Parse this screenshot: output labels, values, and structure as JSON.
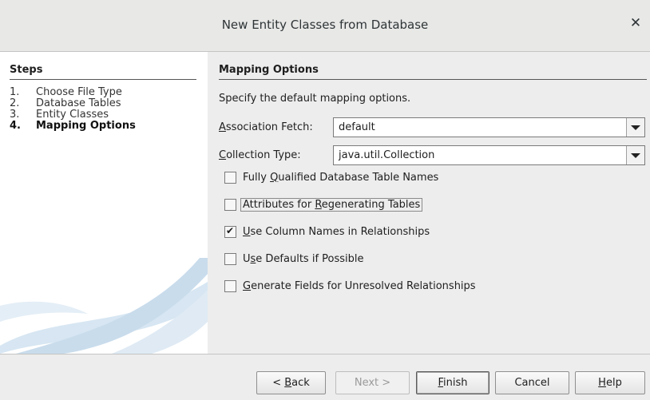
{
  "dialog": {
    "title": "New Entity Classes from Database"
  },
  "steps": {
    "heading": "Steps",
    "items": [
      {
        "num": "1.",
        "label": "Choose File Type"
      },
      {
        "num": "2.",
        "label": "Database Tables"
      },
      {
        "num": "3.",
        "label": "Entity Classes"
      },
      {
        "num": "4.",
        "label": "Mapping Options"
      }
    ]
  },
  "panel": {
    "heading": "Mapping Options",
    "description": "Specify the default mapping options.",
    "association_fetch": {
      "label_mn": "A",
      "label_rest": "ssociation Fetch:",
      "value": "default"
    },
    "collection_type": {
      "label_mn": "C",
      "label_rest": "ollection Type:",
      "value": "java.util.Collection"
    },
    "checkboxes": [
      {
        "pre": "Fully ",
        "mn": "Q",
        "post": "ualified Database Table Names",
        "checked": false
      },
      {
        "pre": "Attributes for ",
        "mn": "R",
        "post": "egenerating Tables",
        "checked": false
      },
      {
        "pre": "",
        "mn": "U",
        "post": "se Column Names in Relationships",
        "checked": true
      },
      {
        "pre": "U",
        "mn": "s",
        "post": "e Defaults if Possible",
        "checked": false
      },
      {
        "pre": "",
        "mn": "G",
        "post": "enerate Fields for Unresolved Relationships",
        "checked": false
      }
    ]
  },
  "buttons": {
    "back": {
      "pre": "< ",
      "mn": "B",
      "post": "ack"
    },
    "next": "Next >",
    "finish": {
      "mn": "F",
      "post": "inish"
    },
    "cancel": "Cancel",
    "help": {
      "mn": "H",
      "post": "elp"
    }
  },
  "colors": {
    "steps_background": "#ffffff",
    "swoosh": "#c9dcec",
    "window_background": "#ededed"
  },
  "icons": {
    "close": "close-icon"
  }
}
